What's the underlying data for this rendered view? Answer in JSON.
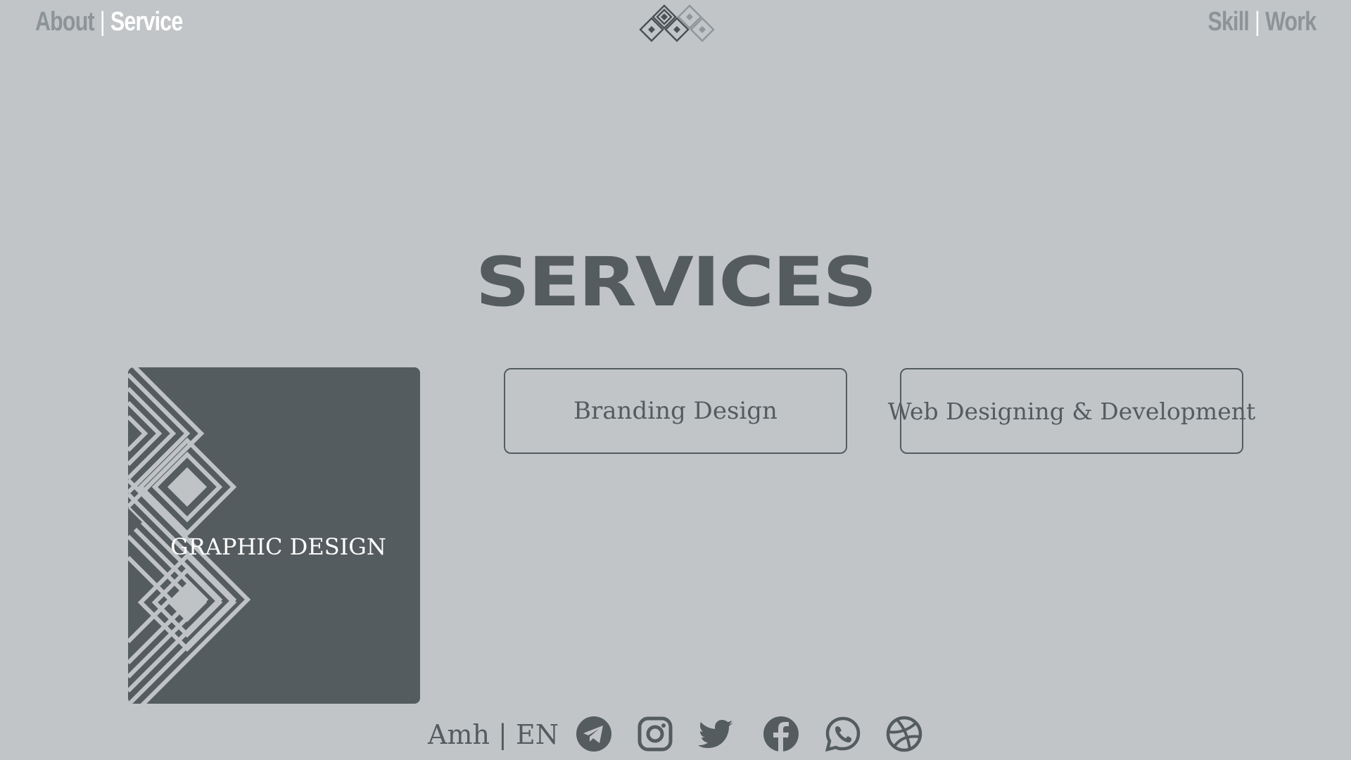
{
  "nav": {
    "left": {
      "about": "About",
      "separator": "|",
      "service": "Service"
    },
    "right": {
      "skill": "Skill",
      "separator": "|",
      "work": "Work"
    }
  },
  "page": {
    "title": "SERVICES"
  },
  "services": {
    "graphic": "GRAPHIC DESIGN",
    "branding": "Branding Design",
    "web": "Web Designing & Development"
  },
  "footer": {
    "language": {
      "amh": "Amh",
      "separator": "|",
      "en": "EN"
    },
    "social_icons": [
      "telegram-icon",
      "instagram-icon",
      "twitter-icon",
      "facebook-icon",
      "whatsapp-icon",
      "dribbble-icon"
    ]
  },
  "colors": {
    "background": "#c1c5c8",
    "primary": "#555c5f",
    "muted": "#8c9497",
    "active": "#ffffff"
  }
}
